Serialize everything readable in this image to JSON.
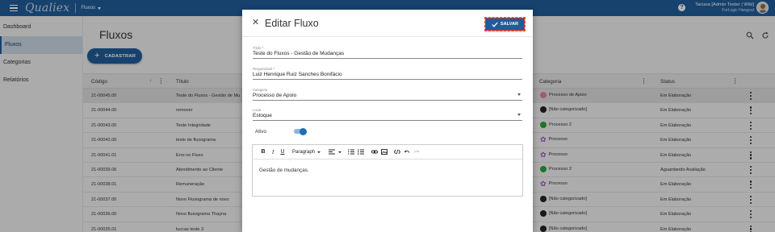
{
  "topbar": {
    "logo": "Qualiex",
    "module": "Fluxos",
    "help_glyph": "?",
    "user_name": "Taciara [Admin Tester | Wiki]",
    "user_company": "ForLogic Hangout"
  },
  "sidebar": {
    "items": [
      {
        "label": "Dashboard"
      },
      {
        "label": "Fluxos"
      },
      {
        "label": "Categorias"
      },
      {
        "label": "Relatórios"
      }
    ]
  },
  "main": {
    "title": "Fluxos",
    "add_label": "CADASTRAR",
    "add_glyph": "+"
  },
  "table": {
    "columns": {
      "code": "Código",
      "title": "Título",
      "category": "Categoria",
      "status": "Status"
    },
    "sort_glyph": "↓",
    "rows": [
      {
        "code": "21-00045.00",
        "title": "Teste do Fluxos - Gestão de Mu",
        "category": "Processo de Apoio",
        "cat_icon": "pink",
        "status": "Em Elaboração"
      },
      {
        "code": "21-00044.00",
        "title": "remover",
        "category": "[Não categorizado]",
        "cat_icon": "black",
        "status": "Em Elaboração"
      },
      {
        "code": "21-00043.00",
        "title": "Teste Integridade",
        "category": "Processo 2",
        "cat_icon": "green",
        "status": "Em Elaboração"
      },
      {
        "code": "21-00042.00",
        "title": "teste de fluxograma",
        "category": "Processo",
        "cat_icon": "gear",
        "status": "Em Elaboração"
      },
      {
        "code": "21-00041.01",
        "title": "Erro no Fluxo",
        "category": "Processo",
        "cat_icon": "gear",
        "status": "Em Elaboração"
      },
      {
        "code": "21-00039.06",
        "title": "Atendimento ao Cliente",
        "category": "Processo 2",
        "cat_icon": "green",
        "status": "Aguardando Avaliação"
      },
      {
        "code": "21-00038.01",
        "title": "Remuneração",
        "category": "Processo",
        "cat_icon": "gear",
        "status": "Em Elaboração"
      },
      {
        "code": "21-00037.00",
        "title": "Novo Fluxograma de novo",
        "category": "[Não categorizado]",
        "cat_icon": "black",
        "status": "Em Elaboração"
      },
      {
        "code": "21-00036.00",
        "title": "Novo fluxograma Thayna",
        "category": "[Não categorizado]",
        "cat_icon": "black",
        "status": "Em Elaboração"
      },
      {
        "code": "21-00035.01",
        "title": "luccas teste 3",
        "category": "[Não categorizado]",
        "cat_icon": "black",
        "status": "Em Elaboração"
      }
    ]
  },
  "modal": {
    "close_glyph": "✕",
    "title": "Editar Fluxo",
    "save_label": "SALVAR",
    "fields": {
      "title": {
        "label": "Título *",
        "value": "Teste do Fluxos - Gestão de Mudanças"
      },
      "responsible": {
        "label": "Responsável *",
        "value": "Luiz Henrique Ruiz Sanches Bonifácio"
      },
      "category": {
        "label": "Categoria",
        "value": "Processo de Apoio"
      },
      "location": {
        "label": "Local",
        "value": "Estoque"
      }
    },
    "active_label": "Ativo",
    "active_on": true,
    "editor": {
      "bold": "B",
      "italic": "I",
      "underline": "U",
      "paragraph": "Paragraph",
      "content": "Gestão de mudanças."
    }
  },
  "colors": {
    "brand": "#1f5c98",
    "category_pink": "#e77ba3",
    "category_green": "#2e9e3b",
    "category_gear": "#9b59b6"
  }
}
